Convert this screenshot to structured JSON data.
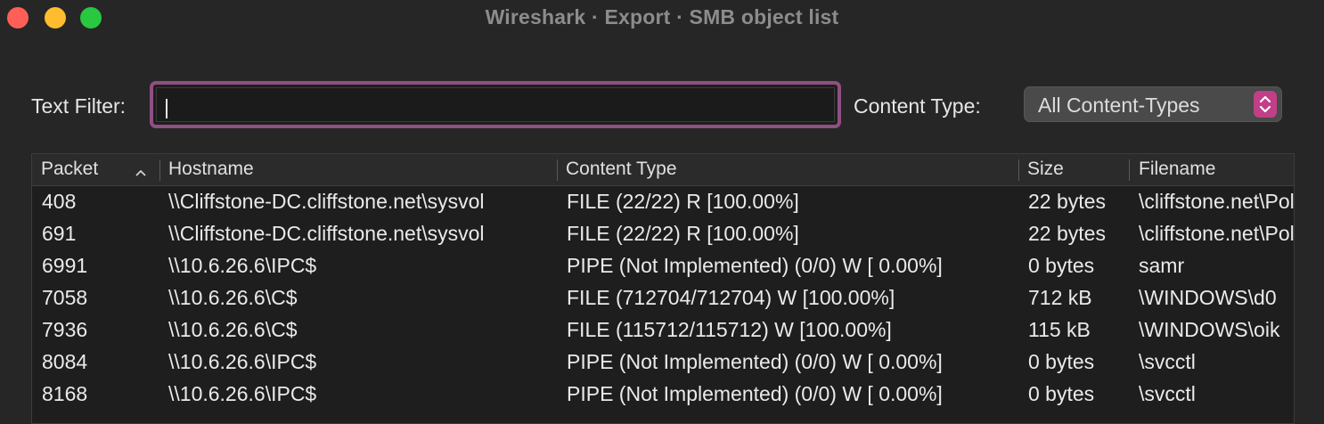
{
  "window": {
    "title": "Wireshark · Export · SMB object list"
  },
  "filter": {
    "label": "Text Filter:",
    "value": ""
  },
  "content_type": {
    "label": "Content Type:",
    "selected": "All Content-Types"
  },
  "table": {
    "columns": [
      "Packet",
      "Hostname",
      "Content Type",
      "Size",
      "Filename"
    ],
    "sort_column": "Packet",
    "sort_direction": "ascending",
    "rows": [
      {
        "packet": "408",
        "hostname": "\\\\Cliffstone-DC.cliffstone.net\\sysvol",
        "content_type": "FILE (22/22) R [100.00%]",
        "size": "22 bytes",
        "filename": "\\cliffstone.net\\Policies\\"
      },
      {
        "packet": "691",
        "hostname": "\\\\Cliffstone-DC.cliffstone.net\\sysvol",
        "content_type": "FILE (22/22) R [100.00%]",
        "size": "22 bytes",
        "filename": "\\cliffstone.net\\Policies\\"
      },
      {
        "packet": "6991",
        "hostname": "\\\\10.6.26.6\\IPC$",
        "content_type": "PIPE (Not Implemented) (0/0) W [ 0.00%]",
        "size": "0 bytes",
        "filename": "samr"
      },
      {
        "packet": "7058",
        "hostname": "\\\\10.6.26.6\\C$",
        "content_type": "FILE (712704/712704) W [100.00%]",
        "size": "712 kB",
        "filename": "\\WINDOWS\\d0"
      },
      {
        "packet": "7936",
        "hostname": "\\\\10.6.26.6\\C$",
        "content_type": "FILE (115712/115712) W [100.00%]",
        "size": "115 kB",
        "filename": "\\WINDOWS\\oik"
      },
      {
        "packet": "8084",
        "hostname": "\\\\10.6.26.6\\IPC$",
        "content_type": "PIPE (Not Implemented) (0/0) W [ 0.00%]",
        "size": "0 bytes",
        "filename": "\\svcctl"
      },
      {
        "packet": "8168",
        "hostname": "\\\\10.6.26.6\\IPC$",
        "content_type": "PIPE (Not Implemented) (0/0) W [ 0.00%]",
        "size": "0 bytes",
        "filename": "\\svcctl"
      }
    ]
  },
  "colors": {
    "accent": "#8f4f83",
    "select_stepper": "#c13f86",
    "close": "#ff5f57",
    "minimize": "#febc2e",
    "maximize": "#28c840"
  },
  "icons": {
    "sort": "chevron-up-icon",
    "select": "up-down-chevron-icon"
  }
}
